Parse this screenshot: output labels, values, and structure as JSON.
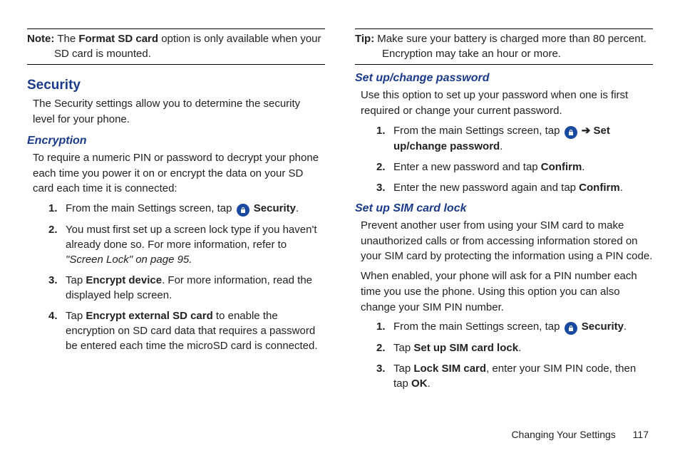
{
  "left": {
    "note": {
      "label": "Note:",
      "line1_before": "The ",
      "line1_bold": "Format SD card",
      "line1_after": " option is only available when your",
      "line2": "SD card is mounted."
    },
    "section_title": "Security",
    "section_intro": "The Security settings allow you to determine the security level for your phone.",
    "encryption_title": "Encryption",
    "encryption_intro": "To require a numeric PIN or password to decrypt your phone each time you power it on or encrypt the data on your SD card each time it is connected:",
    "steps": {
      "s1_num": "1.",
      "s1_before": "From the main Settings screen, tap ",
      "s1_bold": " Security",
      "s1_after": ".",
      "s2_num": "2.",
      "s2_before": "You must first set up a screen lock type if you haven't already done so. For more information, refer to ",
      "s2_italic": "\"Screen Lock\"  on page 95.",
      "s3_num": "3.",
      "s3_before": "Tap ",
      "s3_bold": "Encrypt device",
      "s3_after": ". For more information, read the displayed help screen.",
      "s4_num": "4.",
      "s4_before": "Tap ",
      "s4_bold": "Encrypt external SD card",
      "s4_after": " to enable the encryption on SD card data that requires a password be entered each time the microSD card is connected."
    }
  },
  "right": {
    "tip": {
      "label": "Tip:",
      "line1": "Make sure your battery is charged more than 80 percent.",
      "line2": "Encryption may take an hour or more."
    },
    "pwd_title": "Set up/change password",
    "pwd_intro": "Use this option to set up your password when one is first required or change your current password.",
    "pwd_steps": {
      "s1_num": "1.",
      "s1_before": "From the main Settings screen, tap ",
      "s1_bold1": " Security",
      "s1_arrow": " ➔ ",
      "s1_bold2": "Set up/change password",
      "s1_after": ".",
      "s2_num": "2.",
      "s2_before": "Enter a new password and tap ",
      "s2_bold": "Confirm",
      "s2_after": ".",
      "s3_num": "3.",
      "s3_before": "Enter the new password again and tap ",
      "s3_bold": "Confirm",
      "s3_after": "."
    },
    "sim_title": "Set up SIM card lock",
    "sim_p1": "Prevent another user from using your SIM card to make unauthorized calls or from accessing information stored on your SIM card by protecting the information using a PIN code.",
    "sim_p2": "When enabled, your phone will ask for a PIN number each time you use the phone. Using this option you can also change your SIM PIN number.",
    "sim_steps": {
      "s1_num": "1.",
      "s1_before": "From the main Settings screen, tap ",
      "s1_bold": " Security",
      "s1_after": ".",
      "s2_num": "2.",
      "s2_before": "Tap ",
      "s2_bold": "Set up SIM card lock",
      "s2_after": ".",
      "s3_num": "3.",
      "s3_before": "Tap ",
      "s3_bold": "Lock SIM card",
      "s3_mid": ", enter your SIM PIN code, then tap ",
      "s3_bold2": "OK",
      "s3_after": "."
    }
  },
  "footer": {
    "title": "Changing Your Settings",
    "page": "117"
  }
}
